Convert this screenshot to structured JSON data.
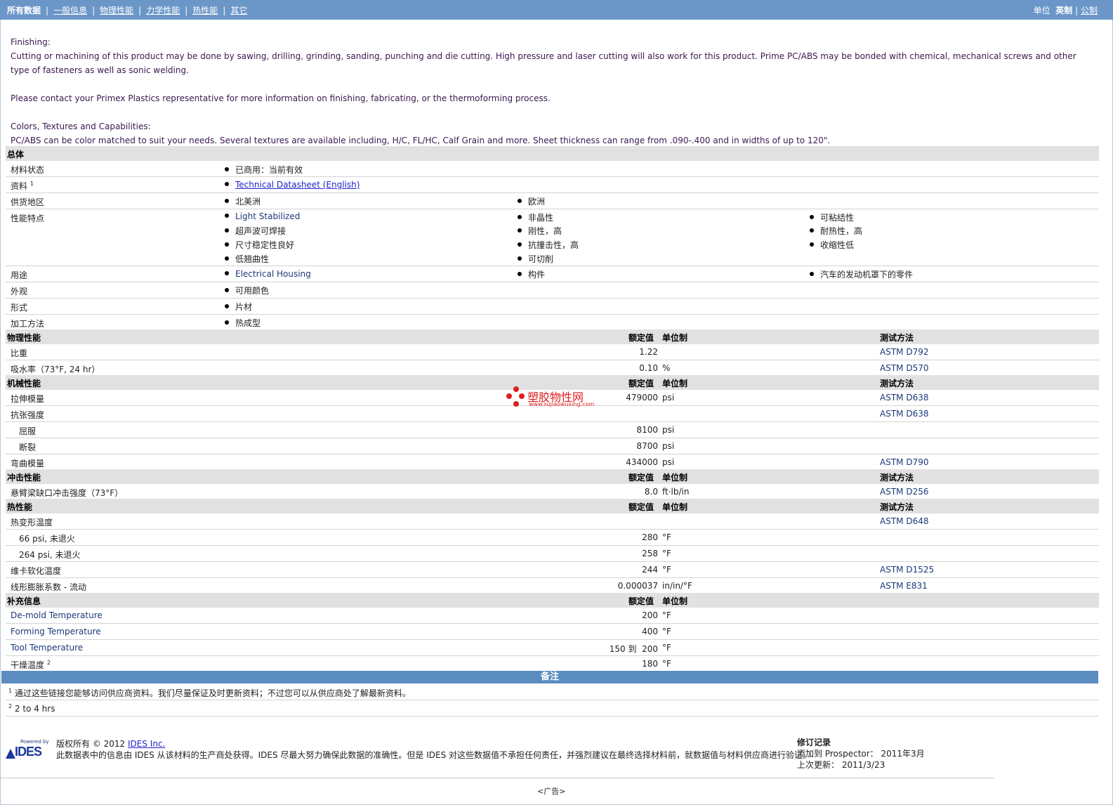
{
  "nav": {
    "items": [
      {
        "label": "所有数据",
        "selected": true
      },
      {
        "label": "一般信息",
        "selected": false
      },
      {
        "label": "物理性能",
        "selected": false
      },
      {
        "label": "力学性能",
        "selected": false
      },
      {
        "label": "热性能",
        "selected": false
      },
      {
        "label": "其它",
        "selected": false
      }
    ],
    "units_label": "单位",
    "unit_english": "英制",
    "unit_metric": "公制"
  },
  "description": {
    "finishing_title": "Finishing:",
    "finishing_text": "Cutting or machining of this product may be done by sawing, drilling, grinding, sanding, punching and die cutting. High pressure and laser cutting will also work for this product. Prime PC/ABS may be bonded with chemical, mechanical screws and other type of fasteners as well as sonic welding.",
    "contact_text": "Please contact your Primex Plastics representative for more information on finishing, fabricating, or the thermoforming process.",
    "colors_title": "Colors, Textures and Capabilities:",
    "colors_text": "PC/ABS can be color matched to suit your needs. Several textures are available including, H/C, FL/HC, Calf Grain and more. Sheet thickness can range from .090-.400 and in widths of up to 120\"."
  },
  "general": {
    "title": "总体",
    "material_status": {
      "label": "材料状态",
      "value": "已商用：当前有效"
    },
    "documents": {
      "label": "资料",
      "sup": "1",
      "link": "Technical Datasheet (English)"
    },
    "availability": {
      "label": "供货地区",
      "values": [
        "北美洲",
        "欧洲"
      ]
    },
    "features": {
      "label": "性能特点",
      "col1": [
        "Light Stabilized",
        "超声波可焊接",
        "尺寸稳定性良好",
        "低翘曲性"
      ],
      "col2": [
        "非晶性",
        "刚性，高",
        "抗撞击性，高",
        "可切削"
      ],
      "col3": [
        "可粘结性",
        "耐热性，高",
        "收缩性低"
      ]
    },
    "uses": {
      "label": "用途",
      "values": [
        "Electrical Housing",
        "构件",
        "汽车的发动机罩下的零件"
      ]
    },
    "appearance": {
      "label": "外观",
      "value": "可用颜色"
    },
    "form": {
      "label": "形式",
      "value": "片材"
    },
    "processing": {
      "label": "加工方法",
      "value": "热成型"
    }
  },
  "headers": {
    "nominal": "额定值",
    "unit": "单位制",
    "test": "测试方法"
  },
  "physical": {
    "title": "物理性能",
    "rows": [
      {
        "label": "比重",
        "value": "1.22",
        "unit": "",
        "test": "ASTM D792"
      },
      {
        "label": "吸水率（73°F, 24 hr）",
        "value": "0.10",
        "unit": "%",
        "test": "ASTM D570"
      }
    ]
  },
  "mechanical": {
    "title": "机械性能",
    "modulus": {
      "label": "拉伸模量",
      "value": "479000",
      "unit": "psi",
      "test": "ASTM D638"
    },
    "strength": {
      "label": "抗张强度",
      "test": "ASTM D638"
    },
    "yield": {
      "label": "屈服",
      "value": "8100",
      "unit": "psi"
    },
    "break": {
      "label": "断裂",
      "value": "8700",
      "unit": "psi"
    },
    "flex": {
      "label": "弯曲模量",
      "value": "434000",
      "unit": "psi",
      "test": "ASTM D790"
    }
  },
  "impact": {
    "title": "冲击性能",
    "izod": {
      "label": "悬臂梁缺口冲击强度（73°F）",
      "value": "8.0",
      "unit": "ft·lb/in",
      "test": "ASTM D256"
    }
  },
  "thermal": {
    "title": "热性能",
    "hdt": {
      "label": "热变形温度",
      "test": "ASTM D648"
    },
    "hdt66": {
      "label": "66 psi, 未退火",
      "value": "280",
      "unit": "°F"
    },
    "hdt264": {
      "label": "264 psi, 未退火",
      "value": "258",
      "unit": "°F"
    },
    "vicat": {
      "label": "维卡软化温度",
      "value": "244",
      "unit": "°F",
      "test": "ASTM D1525"
    },
    "clte": {
      "label": "线形膨胀系数 - 流动",
      "value": "0.000037",
      "unit": "in/in/°F",
      "test": "ASTM E831"
    }
  },
  "supplemental": {
    "title": "补充信息",
    "demold": {
      "label": "De-mold Temperature",
      "value": "200",
      "unit": "°F"
    },
    "forming": {
      "label": "Forming Temperature",
      "value": "400",
      "unit": "°F"
    },
    "tool": {
      "label": "Tool Temperature",
      "value": "150 到  200",
      "unit": "°F"
    },
    "drying": {
      "label": "干燥温度",
      "sup": "2",
      "value": "180",
      "unit": "°F"
    }
  },
  "notes": {
    "title": "备注",
    "n1": {
      "sup": "1",
      "text": "通过这些链接您能够访问供应商资料。我们尽量保证及时更新资料；不过您可以从供应商处了解最新资料。"
    },
    "n2": {
      "sup": "2",
      "text": "2 to 4 hrs"
    }
  },
  "footer": {
    "powered_by": "Powered by",
    "logo_text": "IDES",
    "copyright_prefix": "版权所有  © 2012",
    "company_link": "IDES Inc.",
    "disclaimer": "此数据表中的信息由  IDES 从该材料的生产商处获得。IDES 尽最大努力确保此数据的准确性。但是  IDES 对这些数据值不承担任何责任，并强烈建议在最终选择材料前，就数据值与材料供应商进行验证。",
    "revision_title": "修订记录",
    "added_label": "添加到  Prospector：  2011年3月",
    "updated_label": "上次更新：  2011/3/23",
    "ad": "<广告>"
  },
  "watermark": {
    "cn": "塑胶物性网",
    "en": "www.sujiaowuxing.com"
  }
}
